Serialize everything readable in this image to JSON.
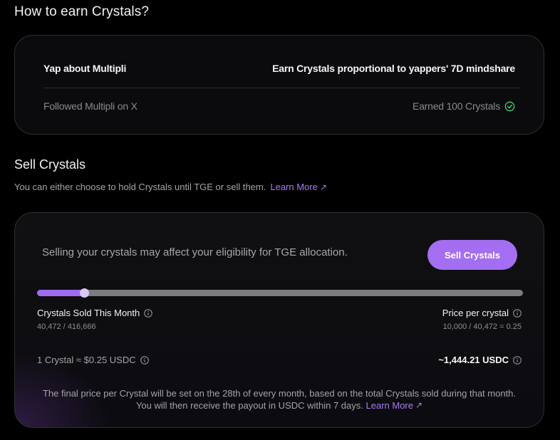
{
  "earn": {
    "title": "How to earn Crystals?",
    "rows": [
      {
        "task": "Yap about Multipli",
        "reward": "Earn Crystals proportional to yappers' 7D mindshare"
      },
      {
        "task": "Followed Multipli on X",
        "reward": "Earned 100 Crystals",
        "status_icon": "check-circle-icon"
      }
    ]
  },
  "sell": {
    "title": "Sell Crystals",
    "subtitle": "You can either choose to hold Crystals until TGE or sell them.",
    "learn_more": "Learn More",
    "arrow": "↗",
    "warning": "Selling your crystals may affect your eligibility for TGE allocation.",
    "button_label": "Sell Crystals",
    "progress_fraction": 0.0971,
    "sold_label": "Crystals Sold This Month",
    "sold_value": "40,472 / 416,666",
    "price_label": "Price per crystal",
    "price_value": "10,000 / 40,472 = 0.25",
    "rate": "1 Crystal ≈ $0.25 USDC",
    "payout": "~1,444.21 USDC",
    "footnote": "The final price per Crystal will be set on the 28th of every month, based on the total Crystals sold during that month. You will then receive the payout in USDC within 7 days.",
    "footnote_link": "Learn More"
  },
  "colors": {
    "accent": "#a46ef2",
    "link": "#a97bf5",
    "success": "#3ecf6e"
  }
}
